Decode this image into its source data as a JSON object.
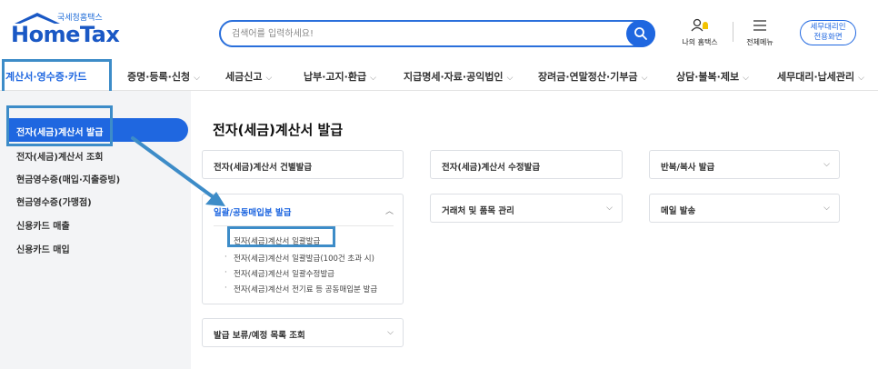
{
  "header": {
    "org_name": "국세청홈택스",
    "logo_text": "HomeTax",
    "search_placeholder": "검색어를 입력하세요!",
    "my_hometax": "나의 홈택스",
    "all_menu": "전체메뉴",
    "agent_button": "세무대리인\n전용화면"
  },
  "gnb": {
    "items": [
      {
        "label": "계산서·영수증·카드"
      },
      {
        "label": "증명·등록·신청"
      },
      {
        "label": "세금신고"
      },
      {
        "label": "납부·고지·환급"
      },
      {
        "label": "지급명세·자료·공익법인"
      },
      {
        "label": "장려금·연말정산·기부금"
      },
      {
        "label": "상담·불복·제보"
      },
      {
        "label": "세무대리·납세관리"
      }
    ]
  },
  "sidebar": {
    "items": [
      {
        "label": "전자(세금)계산서 발급"
      },
      {
        "label": "전자(세금)계산서 조회"
      },
      {
        "label": "현금영수증(매입·지출증빙)"
      },
      {
        "label": "현금영수증(가맹점)"
      },
      {
        "label": "신용카드 매출"
      },
      {
        "label": "신용카드 매입"
      }
    ]
  },
  "main": {
    "title": "전자(세금)계산서 발급",
    "cards": {
      "individual": "전자(세금)계산서 건별발급",
      "modify": "전자(세금)계산서 수정발급",
      "repeat": "반복/복사 발급",
      "partner": "거래처 및 품목 관리",
      "email": "메일 발송",
      "pending": "발급 보류/예정 목록 조회"
    },
    "bulk": {
      "title": "일괄/공동매입분 발급",
      "items": [
        "전자(세금)계산서 일괄발급",
        "전자(세금)계산서 일괄발급(100건 초과 시)",
        "전자(세금)계산서 일괄수정발급",
        "전자(세금)계산서 전기료 등 공동매입분 발급"
      ]
    }
  },
  "colors": {
    "accent": "#1f67e0",
    "highlight": "#3d8cc8",
    "sidebar_bg": "#f3f4f6"
  }
}
